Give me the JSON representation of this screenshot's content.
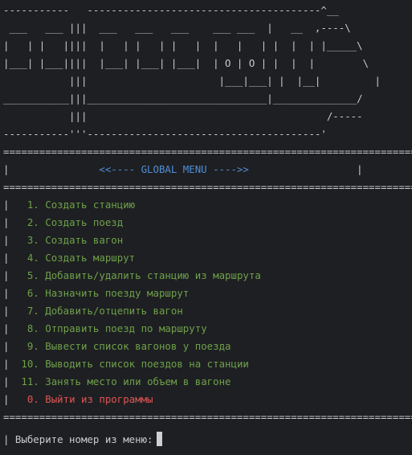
{
  "ascii_art": [
    "-----------   ---------------------------------------^__",
    " ___   ___ |||  ___   ___   ___    ___ ___  |   __  ,----\\",
    "|   | |   ||||  |   | |   | |   |  |   |   | |  |  | |_____\\",
    "|___| |___||||  |___| |___| |___|  | O | O | |  |  |        \\",
    "           |||                      |___|___| |  |__|         |",
    "___________|||______________________________|______________/",
    "           |||                                        /-----",
    "-----------'''---------------------------------------'"
  ],
  "menu": {
    "top_rule": "=======================================================================",
    "title_left": "|               ",
    "title": "<<---- GLOBAL MENU ---->>",
    "title_right": "                  |",
    "mid_rule": "=======================================================================",
    "items": [
      {
        "number": "1.",
        "label": "Создать станцию"
      },
      {
        "number": "2.",
        "label": "Создать поезд"
      },
      {
        "number": "3.",
        "label": "Создать вагон"
      },
      {
        "number": "4.",
        "label": "Создать маршрут"
      },
      {
        "number": "5.",
        "label": "Добавить/удалить станцию из маршрута"
      },
      {
        "number": "6.",
        "label": "Назначить поезду маршрут"
      },
      {
        "number": "7.",
        "label": "Добавить/отцепить вагон"
      },
      {
        "number": "8.",
        "label": "Отправить поезд по маршруту"
      },
      {
        "number": "9.",
        "label": "Вывести список вагонов у поезда"
      },
      {
        "number": "10.",
        "label": "Выводить список поездов на станции"
      },
      {
        "number": "11.",
        "label": "Занять место или объем в вагоне"
      }
    ],
    "exit_item": {
      "number": "0.",
      "label": "Выйти из программы"
    },
    "bottom_rule": "======================================================================="
  },
  "prompt": {
    "text": "| Выберите номер из меню:"
  },
  "colors": {
    "background": "#1e1f22",
    "text": "#c9cbd0",
    "menu_title": "#4f8fd8",
    "menu_item": "#6ea14a",
    "exit_item": "#e05555"
  }
}
